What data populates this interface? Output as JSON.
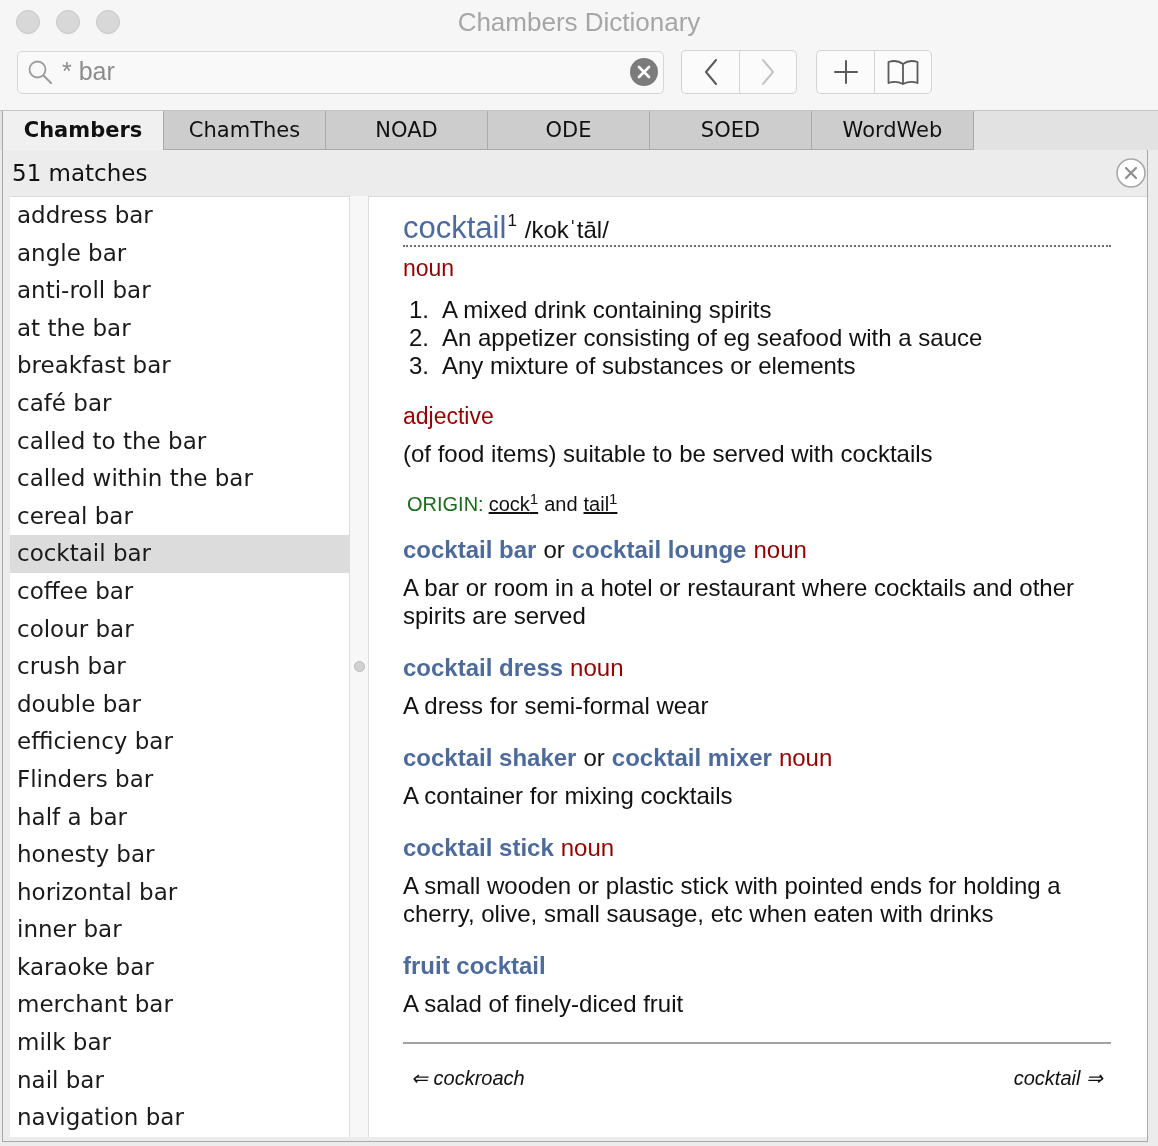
{
  "window": {
    "title": "Chambers Dictionary"
  },
  "toolbar": {
    "search": {
      "value": "* bar"
    },
    "history": [
      {
        "kind": "back",
        "disabled": false
      },
      {
        "kind": "forward",
        "disabled": true
      }
    ],
    "actions": [
      {
        "kind": "add",
        "disabled": false
      },
      {
        "kind": "bookmarks",
        "disabled": false
      }
    ]
  },
  "tabs": [
    {
      "label": "Chambers",
      "selected": true
    },
    {
      "label": "ChamThes",
      "selected": false
    },
    {
      "label": "NOAD",
      "selected": false
    },
    {
      "label": "ODE",
      "selected": false
    },
    {
      "label": "SOED",
      "selected": false
    },
    {
      "label": "WordWeb",
      "selected": false
    }
  ],
  "results": {
    "count": "51 matches",
    "items": [
      {
        "label": "address bar",
        "selected": false
      },
      {
        "label": "angle bar",
        "selected": false
      },
      {
        "label": "anti-roll bar",
        "selected": false
      },
      {
        "label": "at the bar",
        "selected": false
      },
      {
        "label": "breakfast bar",
        "selected": false
      },
      {
        "label": "café bar",
        "selected": false
      },
      {
        "label": "called to the bar",
        "selected": false
      },
      {
        "label": "called within the bar",
        "selected": false
      },
      {
        "label": "cereal bar",
        "selected": false
      },
      {
        "label": "cocktail bar",
        "selected": true
      },
      {
        "label": "coffee bar",
        "selected": false
      },
      {
        "label": "colour bar",
        "selected": false
      },
      {
        "label": "crush bar",
        "selected": false
      },
      {
        "label": "double bar",
        "selected": false
      },
      {
        "label": "efficiency bar",
        "selected": false
      },
      {
        "label": "Flinders bar",
        "selected": false
      },
      {
        "label": "half a bar",
        "selected": false
      },
      {
        "label": "honesty bar",
        "selected": false
      },
      {
        "label": "horizontal bar",
        "selected": false
      },
      {
        "label": "inner bar",
        "selected": false
      },
      {
        "label": "karaoke bar",
        "selected": false
      },
      {
        "label": "merchant bar",
        "selected": false
      },
      {
        "label": "milk bar",
        "selected": false
      },
      {
        "label": "nail bar",
        "selected": false
      },
      {
        "label": "navigation bar",
        "selected": false
      }
    ]
  },
  "entry": {
    "headword": "cocktail",
    "homograph": "1",
    "pronunciation": "/kokˈtāl/",
    "senses": [
      {
        "part_of_speech": "noun",
        "definitions": [
          {
            "number": "1.",
            "text": "A mixed drink containing spirits"
          },
          {
            "number": "2.",
            "text": "An appetizer consisting of eg seafood with a sauce"
          },
          {
            "number": "3.",
            "text": "Any mixture of substances or elements"
          }
        ]
      },
      {
        "part_of_speech": "adjective",
        "definitions": [
          {
            "text": "(of food items) suitable to be served with cocktails"
          }
        ]
      }
    ],
    "origin": {
      "label": "ORIGIN:",
      "parts": [
        {
          "kind": "link",
          "text": "cock",
          "superscript": "1"
        },
        {
          "kind": "text",
          "text": "and"
        },
        {
          "kind": "link",
          "text": "tail",
          "superscript": "1"
        }
      ]
    },
    "derivatives": [
      {
        "heading": [
          {
            "kind": "term",
            "text": "cocktail bar"
          },
          {
            "kind": "text",
            "text": "or"
          },
          {
            "kind": "term",
            "text": "cocktail lounge"
          },
          {
            "kind": "pos",
            "text": "noun"
          }
        ],
        "definition": "A bar or room in a hotel or restaurant where cocktails and other spirits are served"
      },
      {
        "heading": [
          {
            "kind": "term",
            "text": "cocktail dress"
          },
          {
            "kind": "pos",
            "text": "noun"
          }
        ],
        "definition": "A dress for semi-formal wear"
      },
      {
        "heading": [
          {
            "kind": "term",
            "text": "cocktail shaker"
          },
          {
            "kind": "text",
            "text": "or"
          },
          {
            "kind": "term",
            "text": "cocktail mixer"
          },
          {
            "kind": "pos",
            "text": "noun"
          }
        ],
        "definition": "A container for mixing cocktails"
      },
      {
        "heading": [
          {
            "kind": "term",
            "text": "cocktail stick"
          },
          {
            "kind": "pos",
            "text": "noun"
          }
        ],
        "definition": "A small wooden or plastic stick with pointed ends for holding a cherry, olive, small sausage, etc when eaten with drinks"
      },
      {
        "heading": [
          {
            "kind": "term",
            "text": "fruit cocktail"
          }
        ],
        "definition": "A salad of finely-diced fruit"
      }
    ],
    "footer": {
      "previous": "⇐ cockroach",
      "next": "cocktail ⇒"
    }
  }
}
